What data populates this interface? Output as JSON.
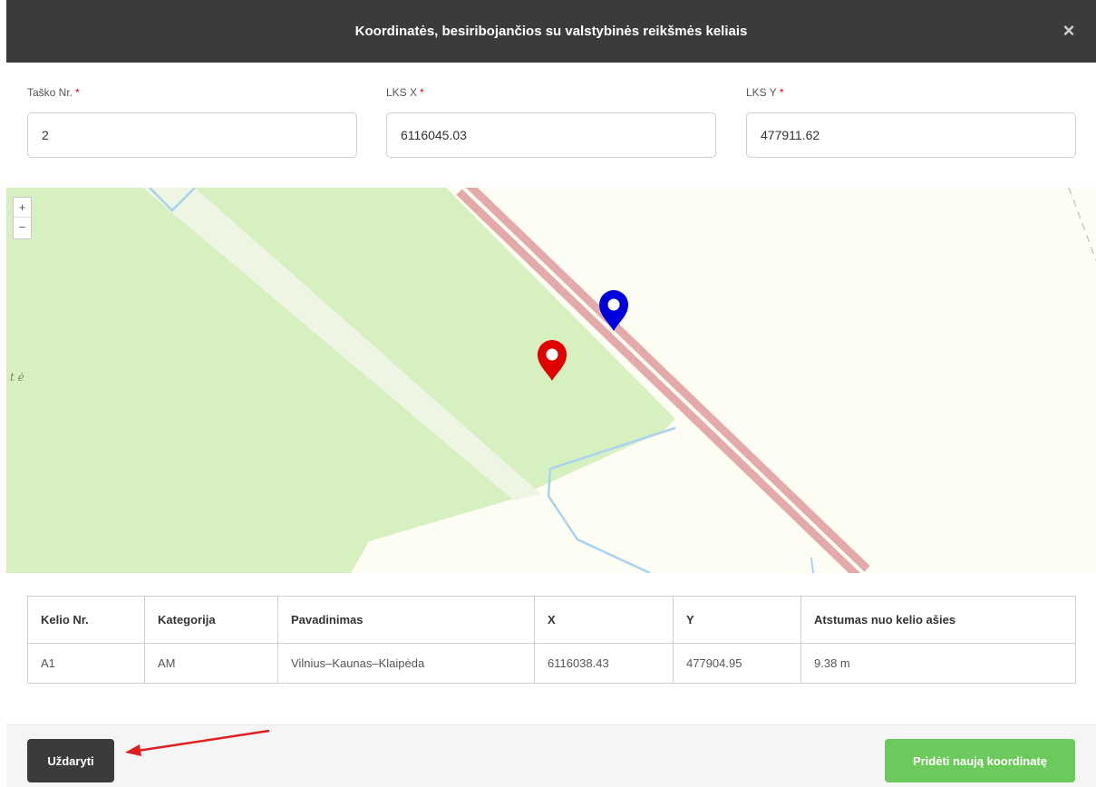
{
  "dialog": {
    "title": "Koordinatės, besiribojančios su valstybinės reikšmės keliais",
    "close_symbol": "×"
  },
  "form": {
    "point_no": {
      "label": "Taško Nr.",
      "required_mark": "*",
      "value": "2"
    },
    "lks_x": {
      "label": "LKS X",
      "required_mark": "*",
      "value": "6116045.03"
    },
    "lks_y": {
      "label": "LKS Y",
      "required_mark": "*",
      "value": "477911.62"
    }
  },
  "map": {
    "zoom_in": "+",
    "zoom_out": "−",
    "place_label": "t ė",
    "markers": [
      {
        "name": "entered-point",
        "color": "#e00000"
      },
      {
        "name": "nearest-road-point",
        "color": "#0000dd"
      }
    ],
    "colors": {
      "forest": "#d6f0c0",
      "road_casing": "#e4aaaa",
      "water": "#a9d3f0",
      "background": "#fdfdf3"
    }
  },
  "table": {
    "headers": [
      "Kelio Nr.",
      "Kategorija",
      "Pavadinimas",
      "X",
      "Y",
      "Atstumas nuo kelio ašies"
    ],
    "rows": [
      [
        "A1",
        "AM",
        "Vilnius–Kaunas–Klaipėda",
        "6116038.43",
        "477904.95",
        "9.38 m"
      ]
    ]
  },
  "footer": {
    "close_label": "Uždaryti",
    "add_label": "Pridėti naują koordinatę"
  },
  "colors": {
    "header_bg": "#3b3b3b",
    "primary_green": "#6cc95c",
    "required_red": "#d0021b",
    "arrow": "#e02020"
  }
}
